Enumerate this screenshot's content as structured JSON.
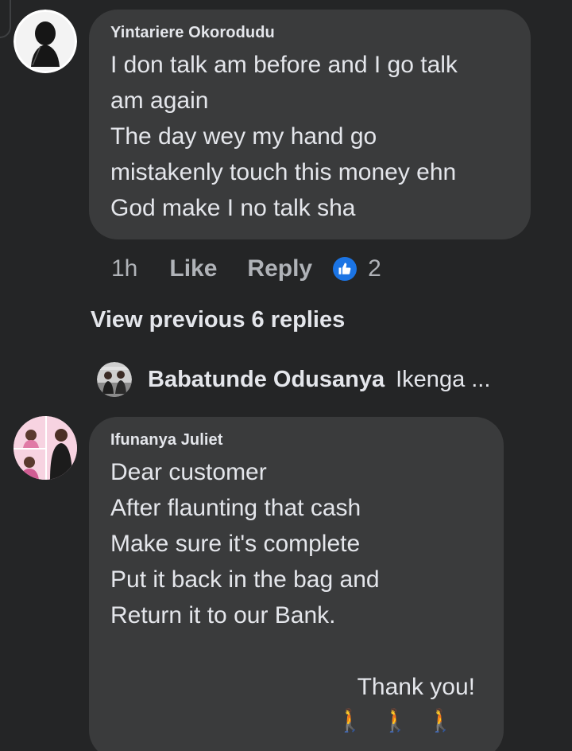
{
  "comments": [
    {
      "author": "Yintariere Okorodudu",
      "lines": [
        "I don talk am before and I go talk",
        "am again",
        "The day wey my hand go",
        "mistakenly touch this money ehn",
        "God make I no talk sha"
      ],
      "time": "1h",
      "like_label": "Like",
      "reply_label": "Reply",
      "reaction_count": "2"
    },
    {
      "author": "Ifunanya Juliet",
      "lines": [
        "Dear customer",
        "After flaunting that cash",
        "Make sure it's complete",
        "Put it back in the bag and",
        "Return it to our Bank."
      ],
      "sign_off": "Thank you!",
      "emoji": "🚶🚶🚶"
    }
  ],
  "view_previous_replies": "View previous 6 replies",
  "reply_preview": {
    "author": "Babatunde Odusanya",
    "text": "Ikenga ..."
  },
  "colors": {
    "background": "#242526",
    "bubble": "#3a3b3c",
    "text": "#e4e6eb",
    "secondary_text": "#b0b3b8",
    "like_blue": "#1b74e4"
  },
  "icons": [
    "thumbs-up-icon",
    "walking-person-icon"
  ]
}
